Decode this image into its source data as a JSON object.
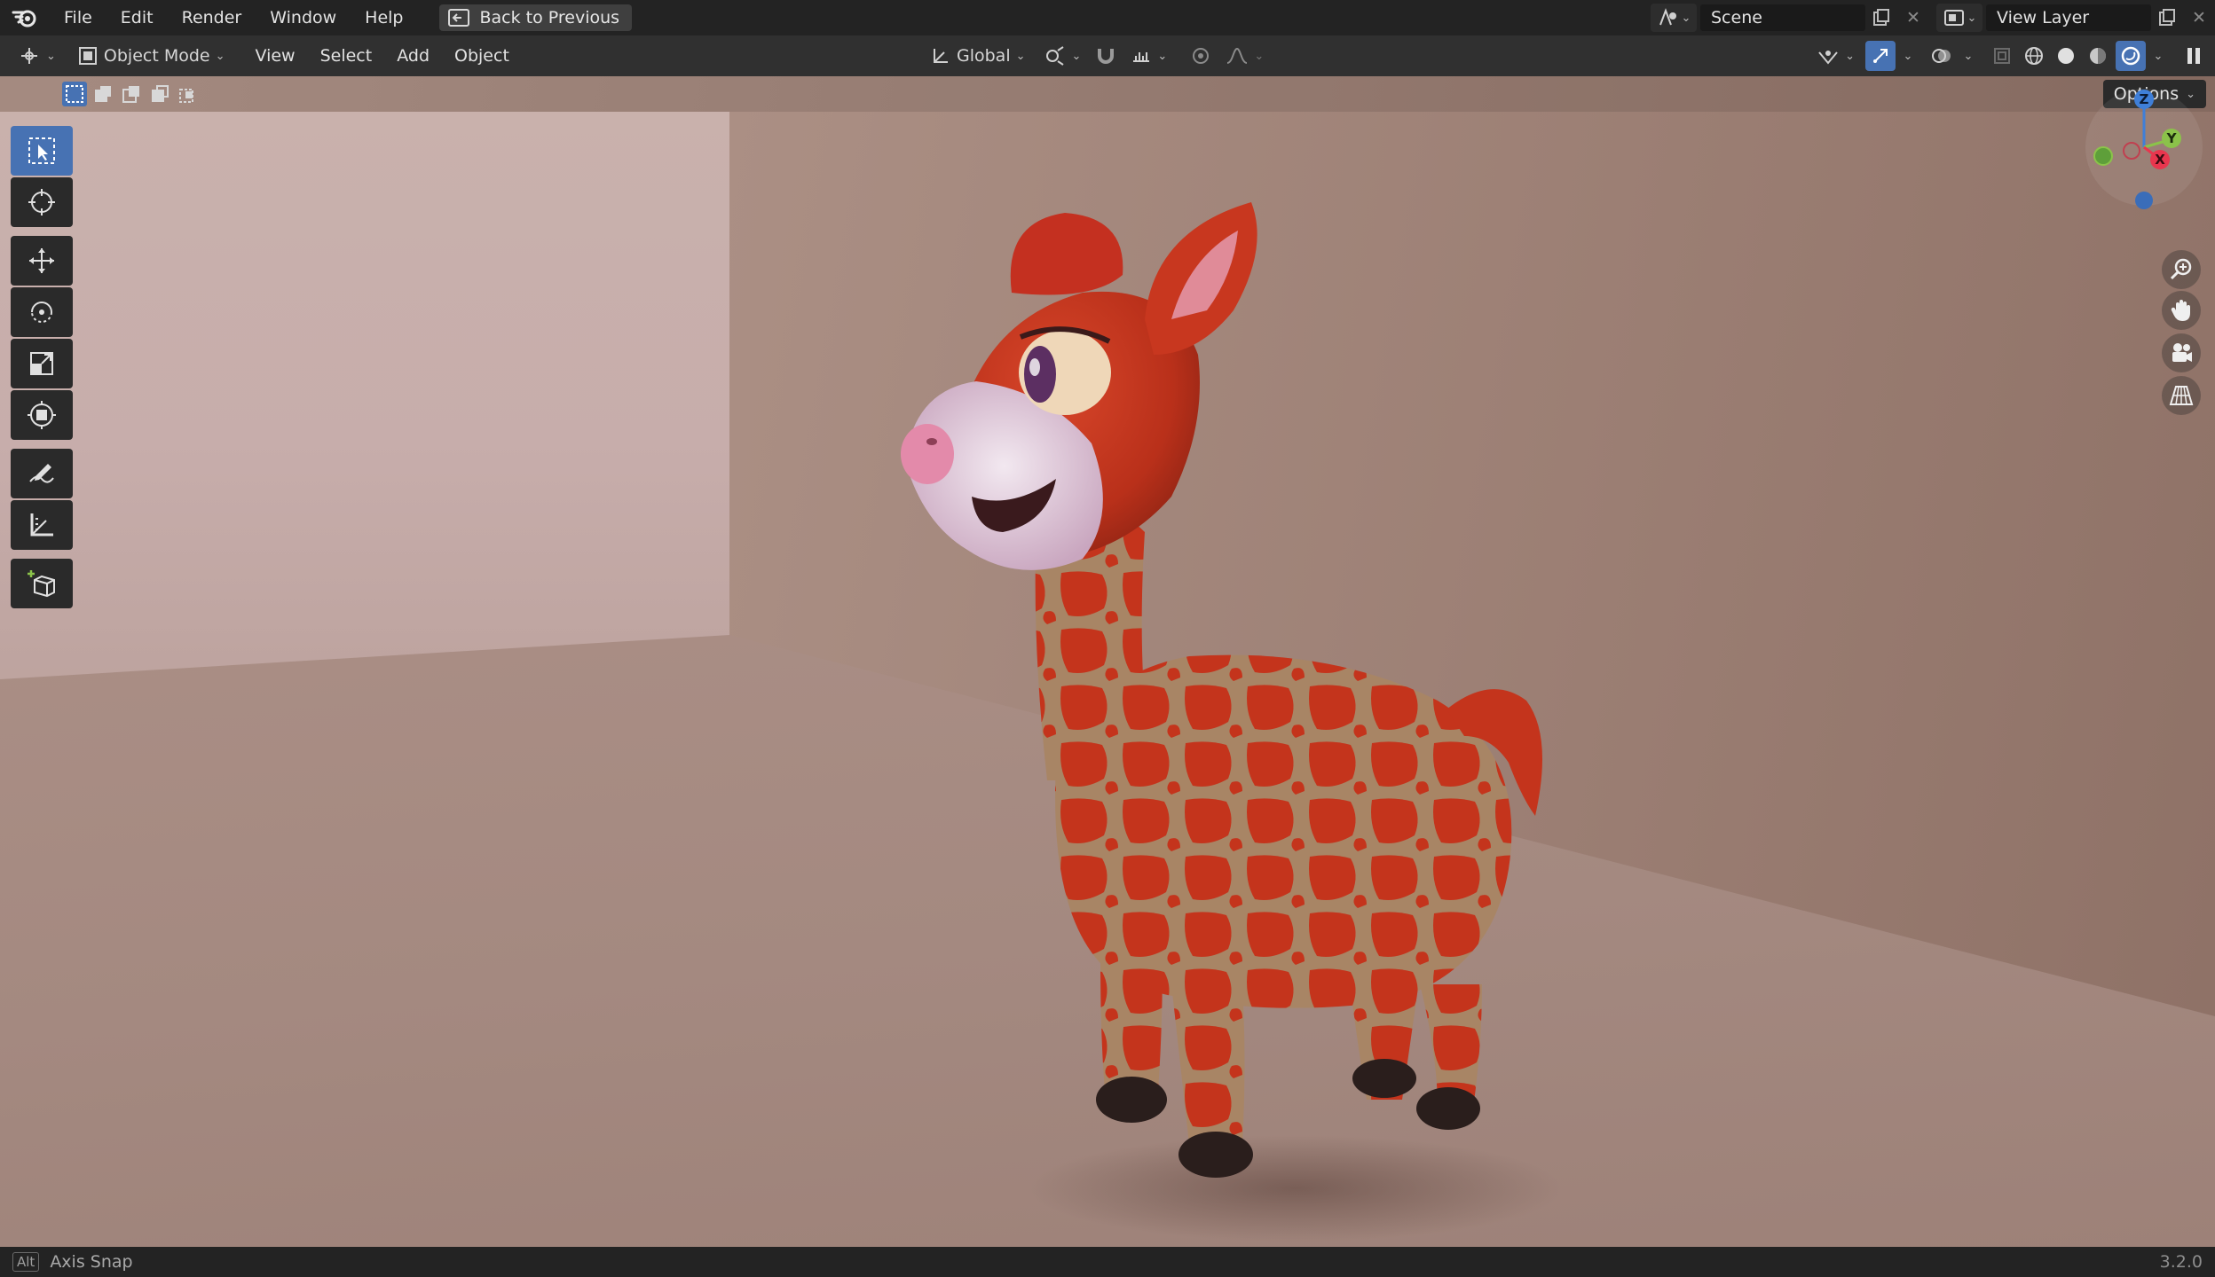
{
  "topbar": {
    "menu": [
      "File",
      "Edit",
      "Render",
      "Window",
      "Help"
    ],
    "back_label": "Back to Previous",
    "scene_label": "Scene",
    "view_layer_label": "View Layer"
  },
  "header": {
    "mode_label": "Object Mode",
    "menus": [
      "View",
      "Select",
      "Add",
      "Object"
    ],
    "orientation_label": "Global"
  },
  "viewport": {
    "options_label": "Options",
    "gizmo": {
      "z": "Z",
      "y": "Y",
      "x": "X"
    }
  },
  "statusbar": {
    "key": "Alt",
    "hint": "Axis Snap",
    "version": "3.2.0"
  },
  "colors": {
    "accent": "#4772b3",
    "axis_x": "#e8364e",
    "axis_y": "#8bc34a",
    "axis_z": "#3f7fd8",
    "giraffe_fur": "#c9361f",
    "giraffe_pattern": "#b08e6d"
  }
}
